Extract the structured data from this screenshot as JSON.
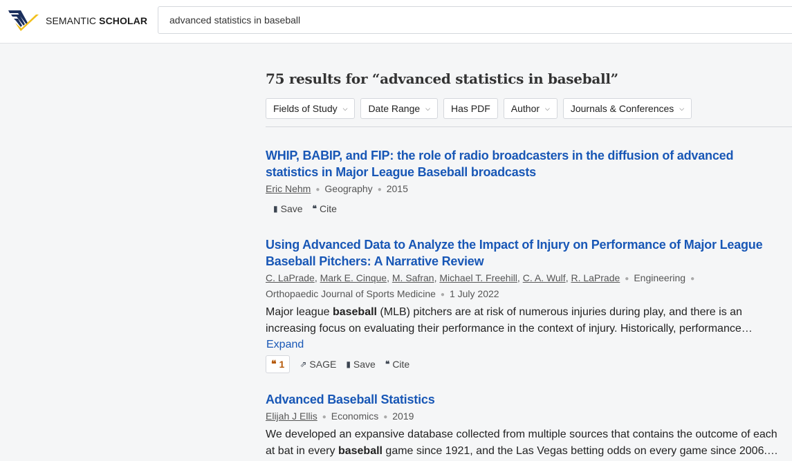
{
  "brand": {
    "name_light": "SEMANTIC ",
    "name_bold": "SCHOLAR"
  },
  "search": {
    "query": "advanced statistics in baseball",
    "icon": "book-logo-icon"
  },
  "results_heading": "75 results for “advanced statistics in baseball”",
  "filters": [
    {
      "label": "Fields of Study",
      "has_dropdown": true
    },
    {
      "label": "Date Range",
      "has_dropdown": true
    },
    {
      "label": "Has PDF",
      "has_dropdown": false
    },
    {
      "label": "Author",
      "has_dropdown": true
    },
    {
      "label": "Journals & Conferences",
      "has_dropdown": true
    }
  ],
  "papers": [
    {
      "title": "WHIP, BABIP, and FIP: the role of radio broadcasters in the diffusion of advanced statistics in Major League Baseball broadcasts",
      "authors": [
        "Eric Nehm"
      ],
      "field": "Geography",
      "date": "2015",
      "actions": {
        "save": "Save",
        "cite": "Cite"
      }
    },
    {
      "title": "Using Advanced Data to Analyze the Impact of Injury on Performance of Major League Baseball Pitchers: A Narrative Review",
      "authors": [
        "C. LaPrade",
        "Mark E. Cinque",
        "M. Safran",
        "Michael T. Freehill",
        "C. A. Wulf",
        "R. LaPrade"
      ],
      "field": "Engineering",
      "venue": "Orthopaedic Journal of Sports Medicine",
      "date": "1 July 2022",
      "abstract_pre": "Major league ",
      "abstract_bold": "baseball",
      "abstract_post": " (MLB) pitchers are at risk of numerous injuries during play, and there is an increasing focus on evaluating their performance in the context of injury. Historically, performance…",
      "expand": "Expand",
      "citations": "1",
      "actions": {
        "publisher": "SAGE",
        "save": "Save",
        "cite": "Cite"
      }
    },
    {
      "title": "Advanced Baseball Statistics",
      "authors": [
        "Elijah J Ellis"
      ],
      "field": "Economics",
      "date": "2019",
      "abstract_pre": "We developed an expansive database collected from multiple sources that contains the outcome of each at bat in every ",
      "abstract_bold": "baseball",
      "abstract_post": " game since 1921, and the Las Vegas betting odds on every game since 2006.…"
    }
  ],
  "colors": {
    "link": "#1857b6",
    "citation_badge": "#b65a0a",
    "logo_yellow": "#f2c01c",
    "logo_navy": "#1b2f5d"
  }
}
